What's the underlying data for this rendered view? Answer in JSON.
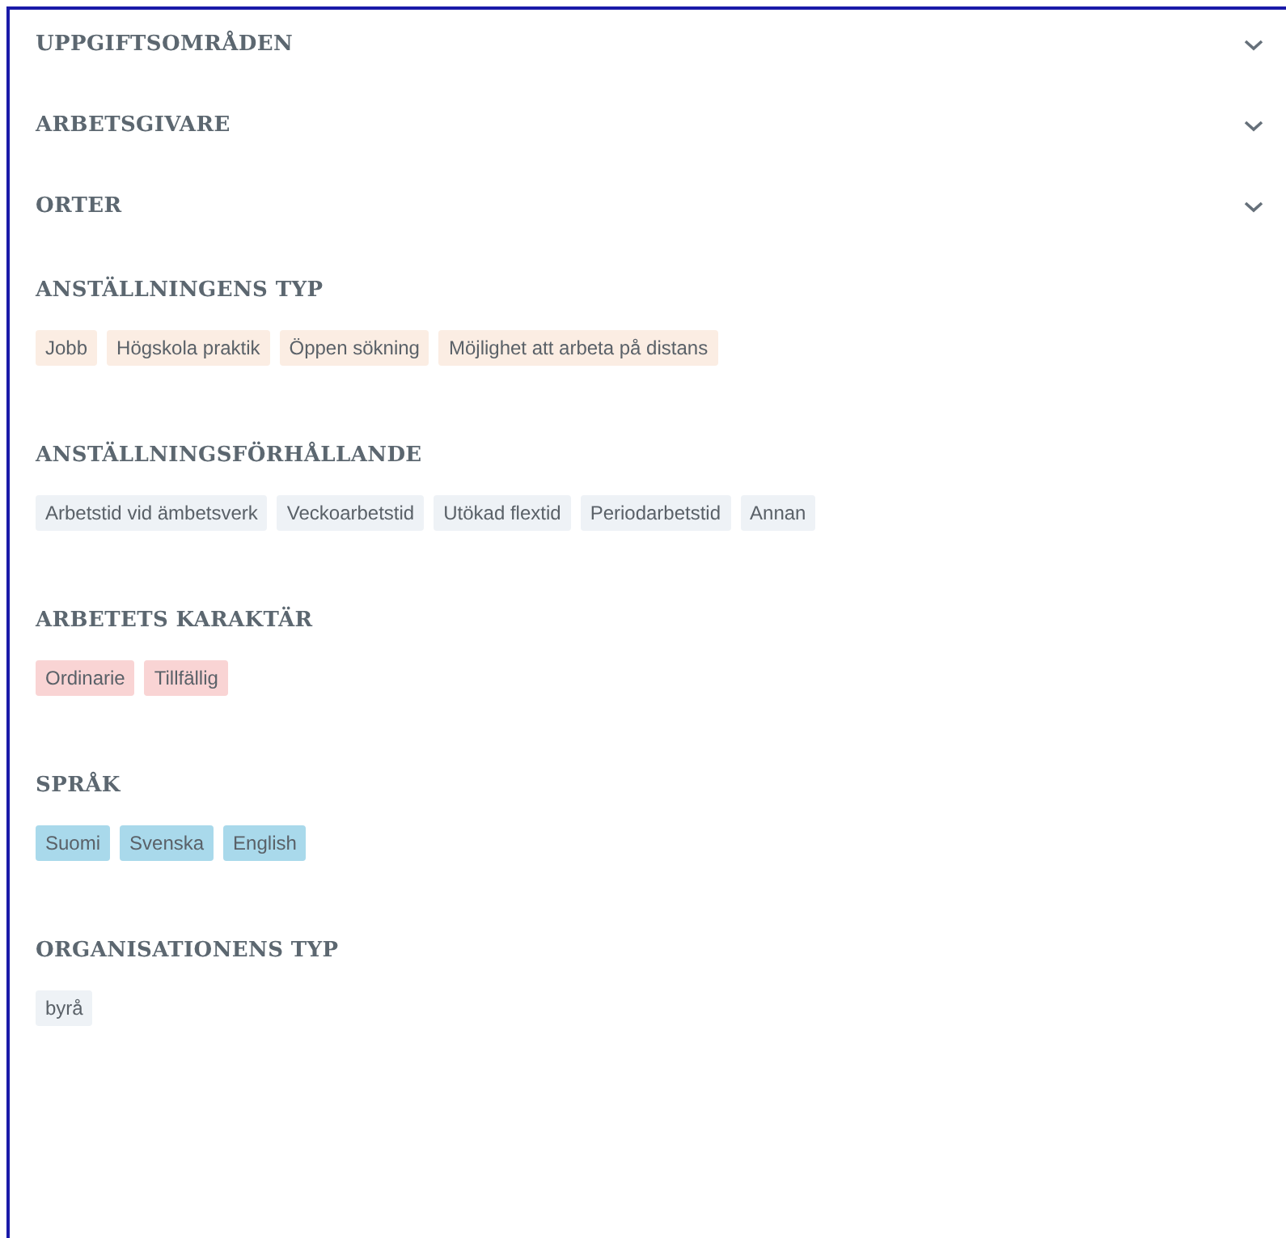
{
  "sections": [
    {
      "kind": "collapsible",
      "title": "UPPGIFTSOMRÅDEN",
      "expanded": false
    },
    {
      "kind": "collapsible",
      "title": "ARBETSGIVARE",
      "expanded": false
    },
    {
      "kind": "collapsible",
      "title": "ORTER",
      "expanded": false
    },
    {
      "kind": "tags",
      "title": "ANSTÄLLNINGENS TYP",
      "color": "#fbede3",
      "tags": [
        "Jobb",
        "Högskola praktik",
        "Öppen sökning",
        "Möjlighet att arbeta på distans"
      ]
    },
    {
      "kind": "tags",
      "title": "ANSTÄLLNINGSFÖRHÅLLANDE",
      "color": "#eef2f6",
      "tags": [
        "Arbetstid vid ämbetsverk",
        "Veckoarbetstid",
        "Utökad flextid",
        "Periodarbetstid",
        "Annan"
      ]
    },
    {
      "kind": "tags",
      "title": "ARBETETS KARAKTÄR",
      "color": "#f9d4d4",
      "tags": [
        "Ordinarie",
        "Tillfällig"
      ]
    },
    {
      "kind": "tags",
      "title": "SPRÅK",
      "color": "#a9d9eb",
      "tags": [
        "Suomi",
        "Svenska",
        "English"
      ]
    },
    {
      "kind": "tags",
      "title": "ORGANISATIONENS TYP",
      "color": "#eef2f6",
      "tags": [
        "byrå"
      ]
    }
  ]
}
